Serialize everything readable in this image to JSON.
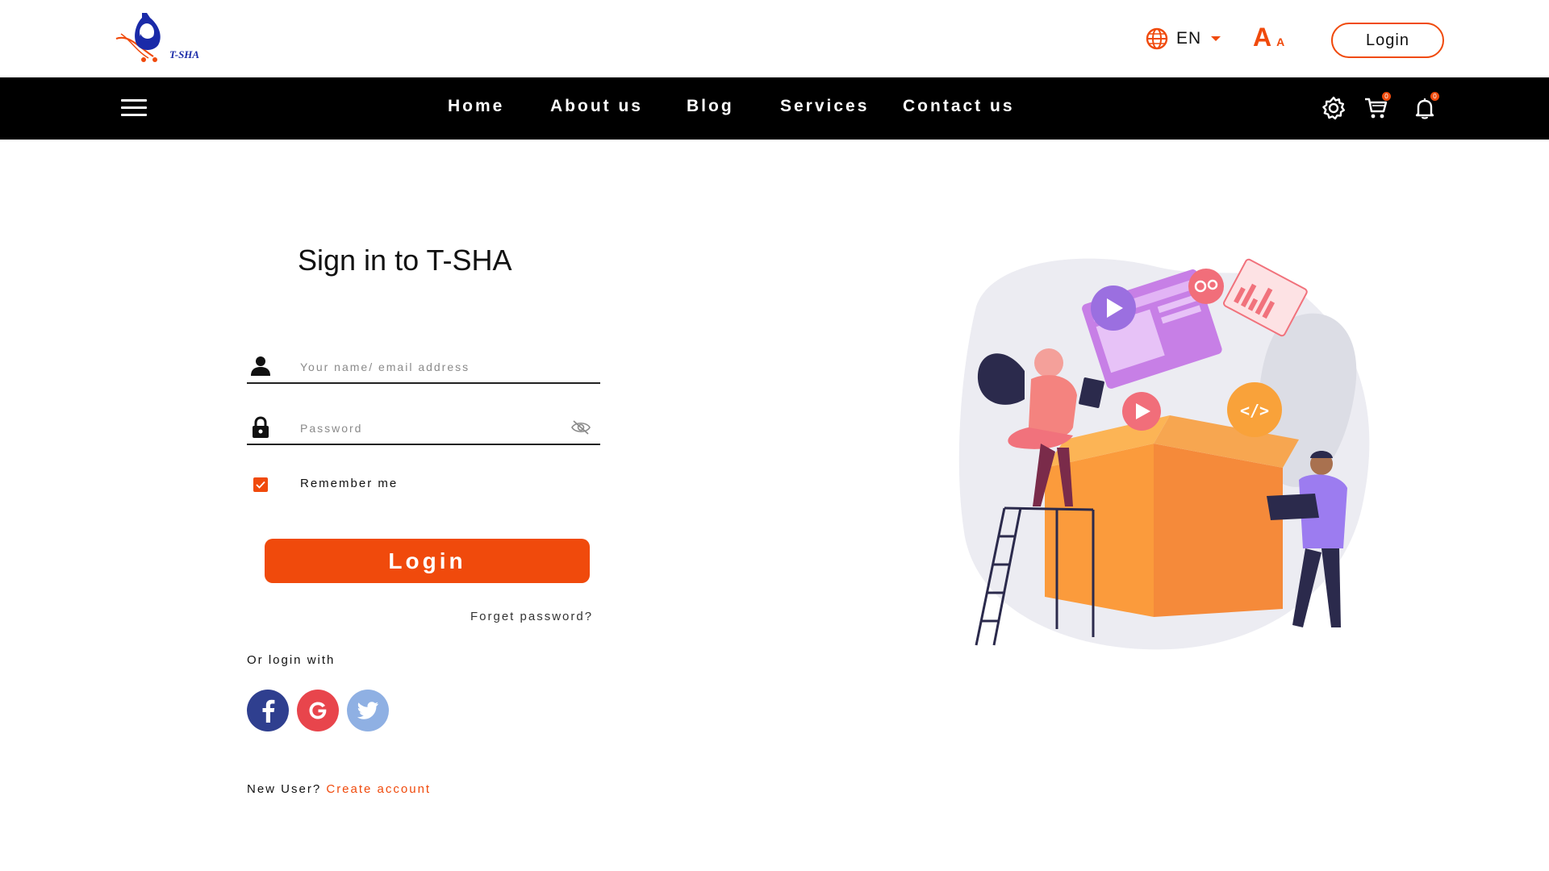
{
  "header": {
    "logo_text": "T-SHA",
    "language": "EN",
    "font_size_large": "A",
    "font_size_small": "A",
    "login_label": "Login"
  },
  "nav": {
    "items": [
      {
        "label": "Home"
      },
      {
        "label": "About us"
      },
      {
        "label": "Blog"
      },
      {
        "label": "Services"
      },
      {
        "label": "Contact us"
      }
    ],
    "cart_badge": "0",
    "notification_badge": "0",
    "icons": [
      "menu-icon",
      "settings-icon",
      "cart-icon",
      "bell-icon"
    ]
  },
  "form": {
    "title": "Sign in to T-SHA",
    "username_placeholder": "Your name/ email address",
    "username_value": "",
    "password_placeholder": "Password",
    "password_value": "",
    "remember_label": "Remember me",
    "remember_checked": true,
    "login_button": "Login",
    "forgot_label": "Forget password?",
    "or_login_with": "Or login with",
    "social": [
      {
        "name": "facebook",
        "glyph": "f",
        "color": "#2f3f8f"
      },
      {
        "name": "google",
        "glyph": "G",
        "color": "#e8454c"
      },
      {
        "name": "twitter",
        "glyph": "twitter-bird",
        "color": "#8fb0e3"
      }
    ],
    "new_user_label": "New User?",
    "create_account_label": "Create account"
  },
  "colors": {
    "accent": "#f04a0c",
    "nav_bg": "#000000",
    "text": "#111111"
  }
}
